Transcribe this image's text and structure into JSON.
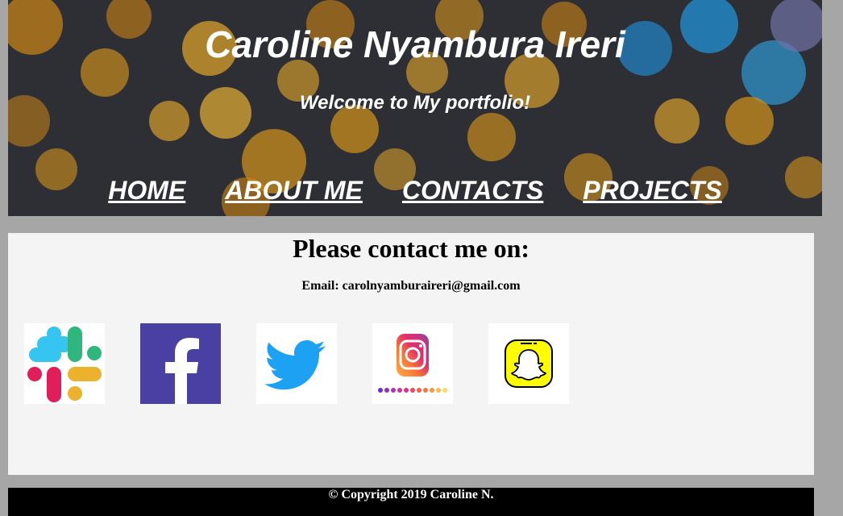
{
  "header": {
    "title": "Caroline Nyambura Ireri",
    "tagline": "Welcome to My portfolio!",
    "nav": [
      {
        "label": "HOME"
      },
      {
        "label": "ABOUT ME"
      },
      {
        "label": "CONTACTS"
      },
      {
        "label": "PROJECTS"
      }
    ]
  },
  "contact": {
    "heading": "Please contact me on:",
    "email_text": "Email: carolnyamburaireri@gmail.com",
    "socials": [
      {
        "name": "slack-icon"
      },
      {
        "name": "facebook-icon"
      },
      {
        "name": "twitter-icon"
      },
      {
        "name": "instagram-icon"
      },
      {
        "name": "snapchat-icon"
      }
    ]
  },
  "footer": {
    "copyright": "© Copyright 2019 Caroline N."
  },
  "colors": {
    "page_background": "#a6a6a6",
    "content_background": "#f4f4f4",
    "footer_background": "#000000",
    "facebook": "#4a3fa3",
    "twitter": "#1da1f2",
    "snapchat": "#fffc00"
  }
}
